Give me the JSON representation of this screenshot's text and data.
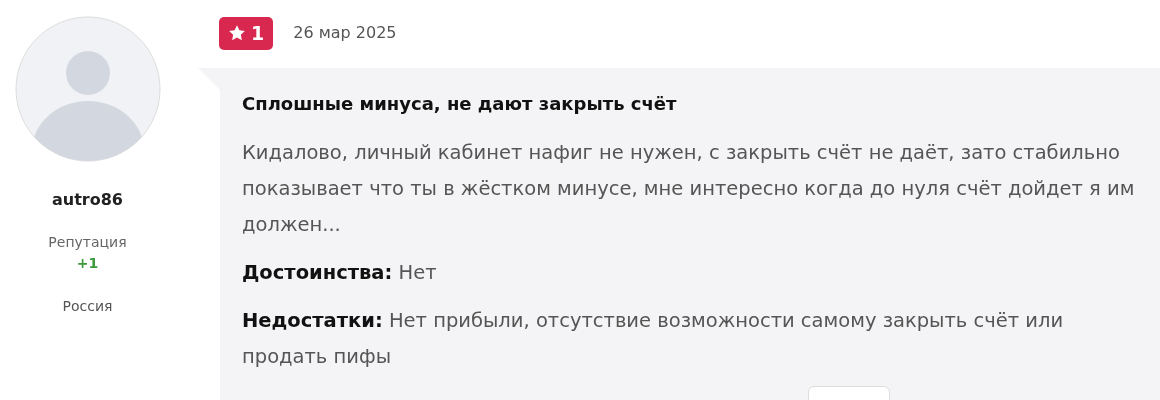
{
  "author": {
    "name": "autro86",
    "reputation_label": "Репутация",
    "reputation_value": "+1",
    "country": "Россия"
  },
  "review": {
    "rating": "1",
    "date": "26 мар 2025",
    "title": "Сплошные минуса, не дают закрыть счёт",
    "text": "Кидалово, личный кабинет нафиг не нужен, с закрыть счёт не даёт, зато стабильно показывает что ты в жёстком минусе, мне интересно когда до нуля счёт дойдет я им должен...",
    "sections": [
      {
        "text": "**Достоинства:** Нет"
      },
      {
        "text": "**Недостатки:** Нет прибыли, отсутствие возможности самому закрыть счёт или продать пифы"
      }
    ]
  }
}
